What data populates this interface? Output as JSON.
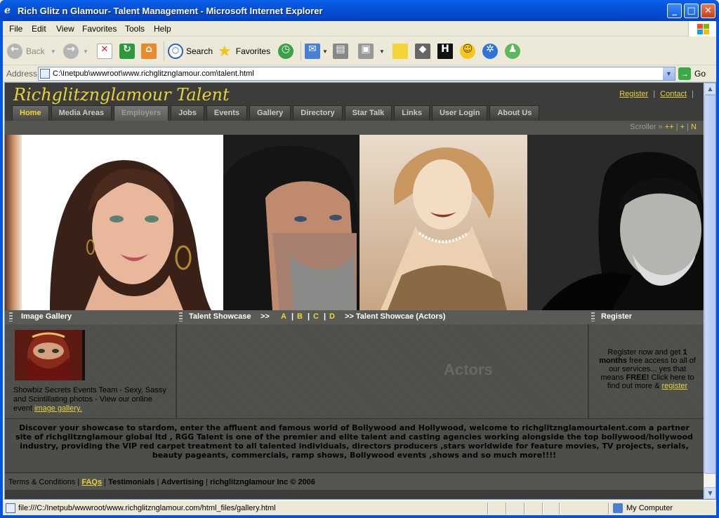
{
  "window": {
    "title": "Rich Glitz n Glamour- Talent Management - Microsoft Internet Explorer",
    "minimize_glyph": "_",
    "maximize_glyph": "□",
    "close_glyph": "✕"
  },
  "menubar": {
    "items": [
      "File",
      "Edit",
      "View",
      "Favorites",
      "Tools",
      "Help"
    ]
  },
  "toolbar": {
    "back_label": "Back",
    "search_label": "Search",
    "favorites_label": "Favorites"
  },
  "address": {
    "label": "Address",
    "url": "C:\\Inetpub\\wwwroot\\www.richglitzngIamour.com\\talent.html",
    "go_label": "Go"
  },
  "site": {
    "logo": "Richglitznglamour Talent",
    "top_links": [
      "Register",
      "Contact"
    ],
    "nav": [
      "Home",
      "Media Areas",
      "Employers",
      "Jobs",
      "Events",
      "Gallery",
      "Directory",
      "Star Talk",
      "Links",
      "User Login",
      "About Us"
    ],
    "scroller_label": "Scroller »",
    "scroller_links": [
      "++",
      "+",
      "N"
    ]
  },
  "sections": {
    "image_gallery": {
      "title": "Image Gallery",
      "text": "Showbiz Secrets Events Team - Sexy, Sassy and Scintillating photos - View our online event ",
      "link": "image gallery."
    },
    "talent_showcase": {
      "title": "Talent Showcase",
      "arrows": ">>",
      "letters": [
        "A",
        "B",
        "C",
        "D"
      ],
      "actors_title": ">> Talent Showcae (Actors)",
      "watermark": "Actors"
    },
    "register": {
      "title": "Register",
      "text_pre": "Register now and get ",
      "months": "1 months",
      "text_mid": " free access to all of our services... yes that means ",
      "free": "FREE!",
      "text_post": " Click here to find out more & ",
      "link": "register"
    }
  },
  "intro": "Discover your showcase to stardom, enter the affluent and famous world of Bollywood and Hollywood, welcome to richglitzngIamourtalent.com a partner site of richglitznglamour global ltd , RGG Talent is one of the premier and elite talent and casting agencies working alongside the top bollywood/hollywood industry, providing the VIP red carpet treatment to all talented individuals, directors producers ,stars worldwide for feature movies, TV projects, serials, beauty pageants, commercials, ramp shows, Bollywood events ,shows and so much more!!!!",
  "footer": {
    "terms": "Terms & Conditions",
    "faqs": "FAQs",
    "testimonials": "Testimonials",
    "advertising": "Advertising",
    "copyright": "richglitzngIamour Inc © 2006"
  },
  "status": {
    "text": "file:///C:/Inetpub/wwwroot/www.richglitznglamour.com/html_files/gallery.html",
    "zone": "My Computer"
  }
}
